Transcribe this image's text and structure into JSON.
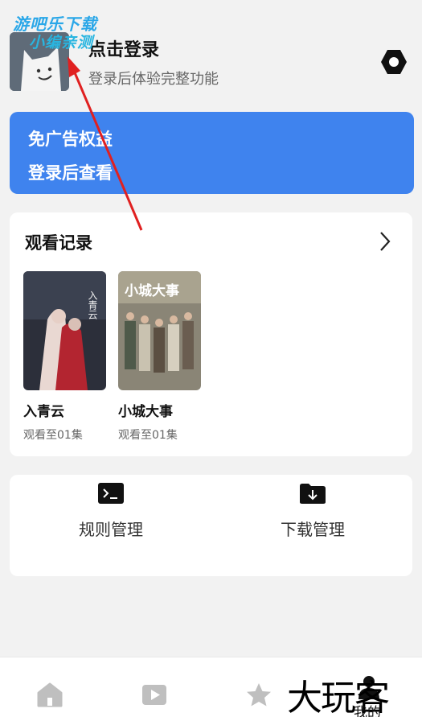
{
  "watermark": {
    "line1": "游吧乐下载",
    "line2": "小编亲测",
    "big": "大玩客"
  },
  "header": {
    "title": "点击登录",
    "subtitle": "登录后体验完整功能",
    "settings_icon": "settings-hexagon-icon"
  },
  "ad_banner": {
    "title": "免广告权益",
    "subtitle": "登录后查看",
    "color": "#3f83ee"
  },
  "history": {
    "title": "观看记录",
    "items": [
      {
        "title": "入青云",
        "progress": "观看至01集",
        "poster_text": "入青云"
      },
      {
        "title": "小城大事",
        "progress": "观看至01集",
        "poster_text": "小城大事"
      }
    ]
  },
  "tools": [
    {
      "label": "规则管理",
      "icon": "terminal-icon"
    },
    {
      "label": "下载管理",
      "icon": "download-folder-icon"
    }
  ],
  "bottom_nav": {
    "items": [
      {
        "icon": "home-icon"
      },
      {
        "icon": "video-play-icon"
      },
      {
        "icon": "star-icon"
      },
      {
        "icon": "profile-icon",
        "label": "我的"
      }
    ]
  }
}
